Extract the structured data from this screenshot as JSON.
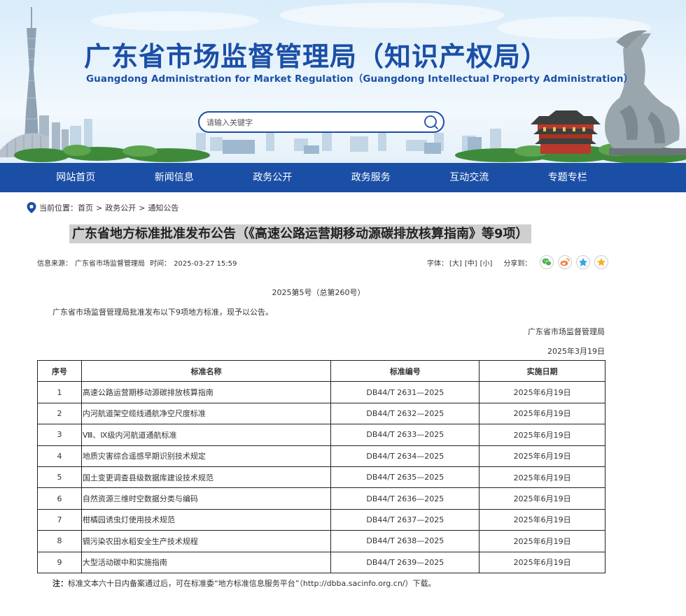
{
  "header": {
    "title": "广东省市场监督管理局（知识产权局）",
    "subtitle": "Guangdong Administration for Market Regulation（Guangdong Intellectual Property Administration）",
    "search_placeholder": "请输入关键字",
    "search_icon": "search-icon"
  },
  "nav": {
    "items": [
      {
        "label": "网站首页"
      },
      {
        "label": "新闻信息"
      },
      {
        "label": "政务公开"
      },
      {
        "label": "政务服务"
      },
      {
        "label": "互动交流"
      },
      {
        "label": "专题专栏"
      }
    ]
  },
  "breadcrumb": {
    "prefix": "当前位置：",
    "items": [
      "首页",
      "政务公开",
      "通知公告"
    ],
    "separator": ">"
  },
  "article": {
    "title": "广东省地方标准批准发布公告（《高速公路运营期移动源碳排放核算指南》等9项）",
    "source_label": "信息来源：",
    "source": "广东省市场监督管理局",
    "time_label": "时间：",
    "time": "2025-03-27 15:59",
    "font_label": "字体：",
    "font_options": [
      "[大]",
      "[中]",
      "[小]"
    ],
    "share_label": "分享到：",
    "doc_number": "2025第5号（总第260号）",
    "intro": "广东省市场监督管理局批准发布以下9项地方标准，现予以公告。",
    "issuer": "广东省市场监督管理局",
    "issue_date": "2025年3月19日",
    "table": {
      "headers": [
        "序号",
        "标准名称",
        "标准编号",
        "实施日期"
      ],
      "rows": [
        [
          "1",
          "高速公路运营期移动源碳排放核算指南",
          "DB44/T 2631—2025",
          "2025年6月19日"
        ],
        [
          "2",
          "内河航道架空缆线通航净空尺度标准",
          "DB44/T 2632—2025",
          "2025年6月19日"
        ],
        [
          "3",
          "Ⅷ、Ⅸ级内河航道通航标准",
          "DB44/T 2633—2025",
          "2025年6月19日"
        ],
        [
          "4",
          "地质灾害综合遥感早期识别技术规定",
          "DB44/T 2634—2025",
          "2025年6月19日"
        ],
        [
          "5",
          "国土变更调查县级数据库建设技术规范",
          "DB44/T 2635—2025",
          "2025年6月19日"
        ],
        [
          "6",
          "自然资源三维时空数据分类与编码",
          "DB44/T 2636—2025",
          "2025年6月19日"
        ],
        [
          "7",
          "柑橘园诱虫灯使用技术规范",
          "DB44/T 2637—2025",
          "2025年6月19日"
        ],
        [
          "8",
          "镉污染农田水稻安全生产技术规程",
          "DB44/T 2638—2025",
          "2025年6月19日"
        ],
        [
          "9",
          "大型活动碳中和实施指南",
          "DB44/T 2639—2025",
          "2025年6月19日"
        ]
      ]
    },
    "note_label": "注：",
    "note": "标准文本六十日内备案通过后，可在标准委“地方标准信息服务平台”（http://dbba.sacinfo.org.cn/）下载。"
  },
  "colors": {
    "brand_blue": "#1b4fa6",
    "title_highlight": "#cfcfcf",
    "wechat_green": "#4caf50",
    "weibo_orange": "#f27c3a",
    "qzone_blue": "#3aa2e8",
    "favorite_yellow": "#f5b022"
  },
  "icons": {
    "location": "location-pin-icon",
    "share": [
      "wechat-icon",
      "weibo-icon",
      "qzone-icon",
      "favorite-icon"
    ]
  }
}
